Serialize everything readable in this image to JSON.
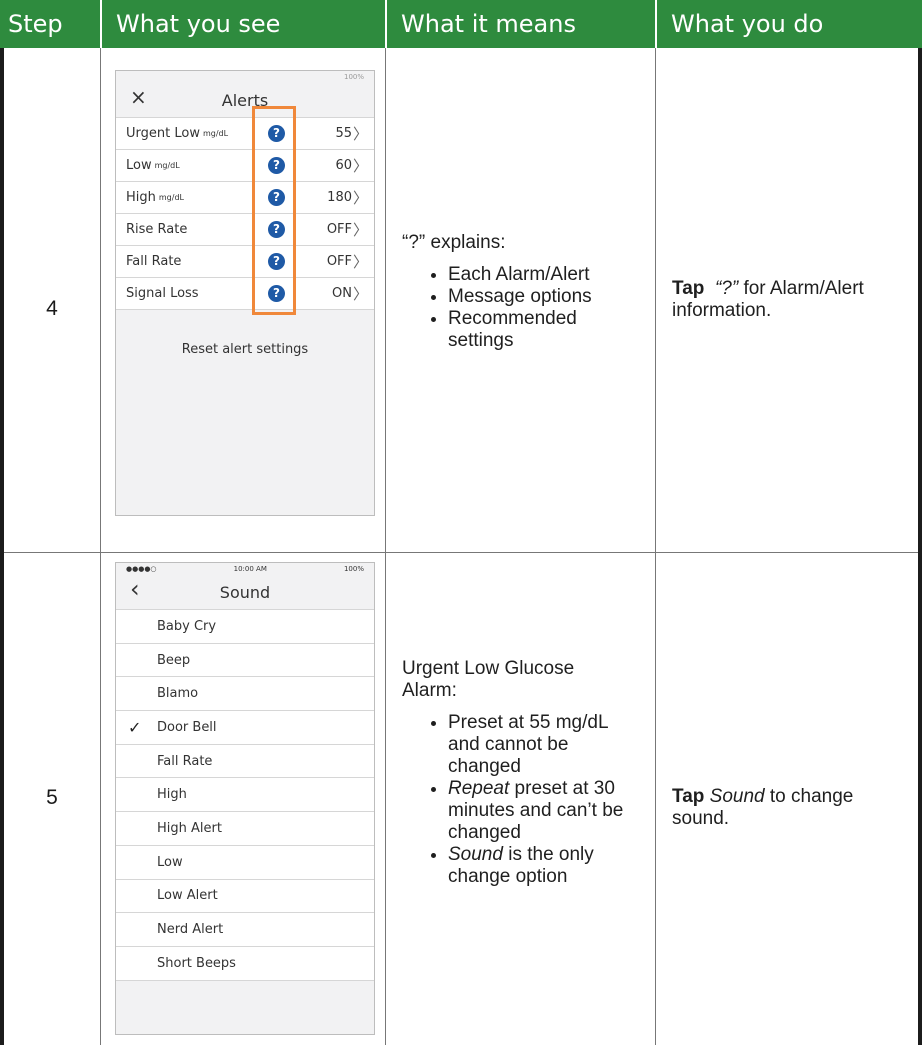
{
  "header": {
    "step": "Step",
    "what_you_see": "What you see",
    "what_it_means": "What it means",
    "what_you_do": "What you do"
  },
  "row4": {
    "step": "4",
    "phone": {
      "status": {
        "time": "",
        "battery": "100%"
      },
      "close_icon": "×",
      "title": "Alerts",
      "rows": [
        {
          "label": "Urgent Low",
          "unit": "mg/dL",
          "value": "55"
        },
        {
          "label": "Low",
          "unit": "mg/dL",
          "value": "60"
        },
        {
          "label": "High",
          "unit": "mg/dL",
          "value": "180"
        },
        {
          "label": "Rise Rate",
          "unit": "",
          "value": "OFF"
        },
        {
          "label": "Fall Rate",
          "unit": "",
          "value": "OFF"
        },
        {
          "label": "Signal Loss",
          "unit": "",
          "value": "ON"
        }
      ],
      "help_icon": "?",
      "reset": "Reset alert settings",
      "highlight_color": "#F0883A",
      "help_icon_color": "#1F5AA6"
    },
    "means": {
      "intro": "“?” explains:",
      "bullets": [
        "Each Alarm/Alert",
        "Message options",
        "Recommended settings"
      ]
    },
    "do": {
      "tap": "Tap",
      "target": "“?”",
      "rest": " for Alarm/Alert information."
    }
  },
  "row5": {
    "step": "5",
    "phone": {
      "status": {
        "signal": "●●●●○",
        "time": "10:00 AM",
        "battery": "100%"
      },
      "back_icon": "‹",
      "title": "Sound",
      "options": [
        "Baby Cry",
        "Beep",
        "Blamo",
        "Door Bell",
        "Fall Rate",
        "High",
        "High Alert",
        "Low",
        "Low Alert",
        "Nerd Alert",
        "Short Beeps"
      ],
      "selected": "Door Bell",
      "check_icon": "✓"
    },
    "means": {
      "intro": "Urgent Low Glucose Alarm:",
      "b1": "Preset at 55 mg/dL and cannot be changed",
      "b2_em": "Repeat",
      "b2_rest": " preset at 30 minutes and can’t be changed",
      "b3_em": "Sound",
      "b3_rest": " is the only change option"
    },
    "do": {
      "tap": "Tap",
      "target": "Sound",
      "rest": " to change sound."
    }
  },
  "colors": {
    "header_bg": "#2E8B3E",
    "header_text": "#FFFFFF"
  }
}
